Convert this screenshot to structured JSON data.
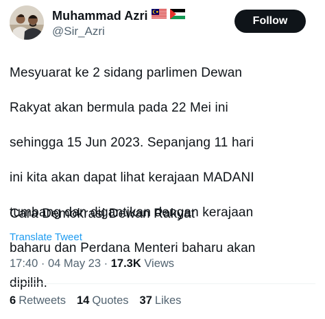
{
  "author": {
    "display_name": "Muhammad Azri",
    "handle": "@Sir_Azri",
    "flags": [
      "malaysia-flag-icon",
      "palestine-flag-icon"
    ]
  },
  "follow_button": {
    "label": "Follow"
  },
  "tweet": {
    "text_lines": [
      "Mesyuarat ke 2 sidang parlimen Dewan",
      "Rakyat akan bermula pada 22 Mei ini",
      "sehingga 15 Jun 2023. Sepanjang 11 hari",
      "ini kita akan dapat lihat kerajaan MADANI",
      "tumbang dan digantikan dengan kerajaan",
      "baharu dan Perdana Menteri baharu akan",
      "dipilih."
    ],
    "text_footer": "Cara Demokrasi Dewan Rakyat",
    "translate_label": "Translate Tweet"
  },
  "meta": {
    "time": "17:40",
    "separator": "·",
    "date": "04 May 23",
    "views_count": "17.3K",
    "views_label": "Views"
  },
  "stats": {
    "retweets_count": "6",
    "retweets_label": "Retweets",
    "quotes_count": "14",
    "quotes_label": "Quotes",
    "likes_count": "37",
    "likes_label": "Likes"
  },
  "colors": {
    "text_primary": "#0f1419",
    "text_secondary": "#536471",
    "link": "#1d9bf0",
    "button_bg": "#0f1419",
    "divider": "#eff3f4"
  }
}
